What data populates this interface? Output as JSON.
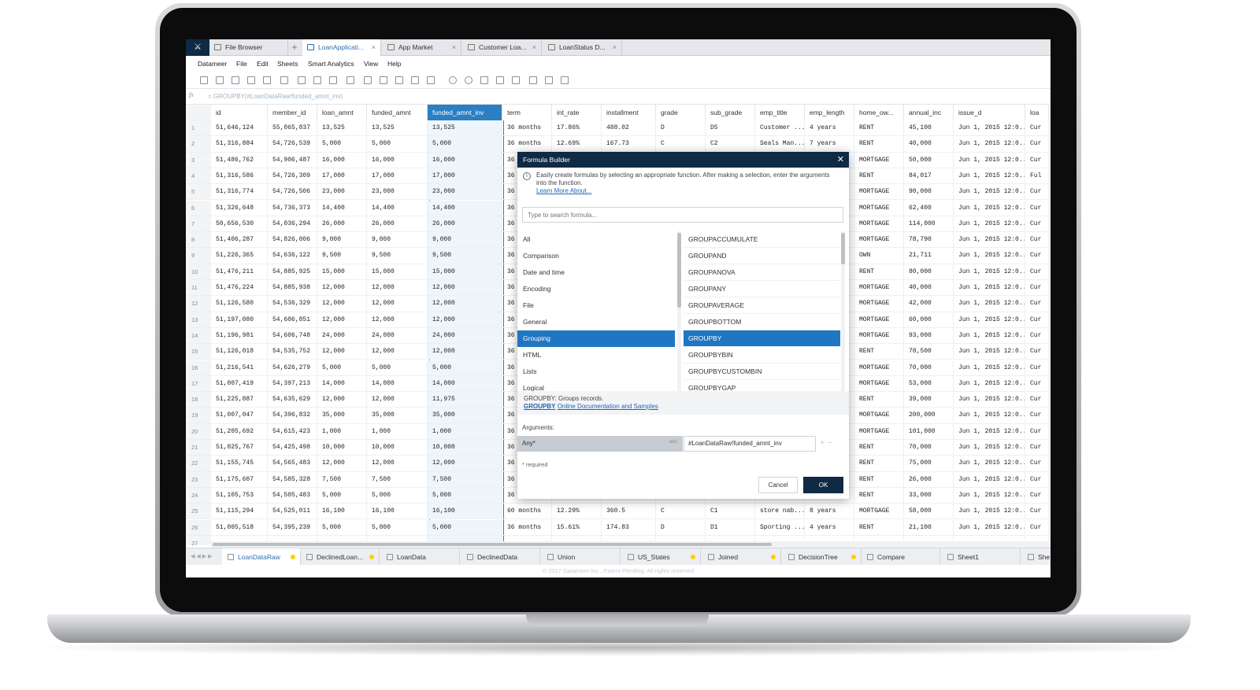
{
  "window_tabs": [
    {
      "label": "File Browser"
    },
    {
      "label": "LoanApplicati..."
    },
    {
      "label": "App Market"
    },
    {
      "label": "Customer Loa..."
    },
    {
      "label": "LoanStatus D..."
    }
  ],
  "menu": [
    "Datameer",
    "File",
    "Edit",
    "Sheets",
    "Smart Analytics",
    "View",
    "Help"
  ],
  "formula_bar": {
    "fx": "fx",
    "text": "= GROUPBY(#LoanDataRaw!funded_amnt_inv)"
  },
  "columns": [
    "id",
    "member_id",
    "loan_amnt",
    "funded_amnt",
    "funded_amnt_inv",
    "term",
    "int_rate",
    "installment",
    "grade",
    "sub_grade",
    "emp_title",
    "emp_length",
    "home_ow...",
    "annual_inc",
    "issue_d",
    "loa"
  ],
  "rows": [
    [
      "1",
      "51,646,124",
      "55,065,837",
      "13,525",
      "13,525",
      "13,525",
      "36 months",
      "17.86%",
      "488.02",
      "D",
      "D5",
      "Customer ...",
      "4 years",
      "RENT",
      "45,100",
      "Jun 1, 2015 12:0...",
      "Cur"
    ],
    [
      "2",
      "51,316,884",
      "54,726,539",
      "5,000",
      "5,000",
      "5,000",
      "36 months",
      "12.69%",
      "167.73",
      "C",
      "C2",
      "Seals Man...",
      "7 years",
      "RENT",
      "40,000",
      "Jun 1, 2015 12:0...",
      "Cur"
    ],
    [
      "3",
      "51,486,762",
      "54,906,487",
      "16,000",
      "16,000",
      "16,000",
      "36",
      "",
      "",
      "",
      "",
      "",
      "",
      "MORTGAGE",
      "50,000",
      "Jun 1, 2015 12:0...",
      "Cur"
    ],
    [
      "4",
      "51,316,586",
      "54,726,309",
      "17,000",
      "17,000",
      "17,000",
      "36",
      "",
      "",
      "",
      "",
      "",
      "",
      "RENT",
      "84,017",
      "Jun 1, 2015 12:0...",
      "Ful"
    ],
    [
      "5",
      "51,316,774",
      "54,726,506",
      "23,000",
      "23,000",
      "23,000",
      "36",
      "",
      "",
      "",
      "",
      "",
      "",
      "MORTGAGE",
      "90,000",
      "Jun 1, 2015 12:0...",
      "Cur"
    ],
    [
      "6",
      "51,326,648",
      "54,736,373",
      "14,400",
      "14,400",
      "14,400",
      "36",
      "",
      "",
      "",
      "",
      "",
      "",
      "MORTGAGE",
      "62,400",
      "Jun 1, 2015 12:0...",
      "Cur"
    ],
    [
      "7",
      "50,656,530",
      "54,036,294",
      "26,000",
      "26,000",
      "26,000",
      "36",
      "",
      "",
      "",
      "",
      "",
      "",
      "MORTGAGE",
      "114,000",
      "Jun 1, 2015 12:0...",
      "Cur"
    ],
    [
      "8",
      "51,406,287",
      "54,826,006",
      "9,000",
      "9,000",
      "9,000",
      "36",
      "",
      "",
      "",
      "",
      "",
      "",
      "MORTGAGE",
      "78,790",
      "Jun 1, 2015 12:0...",
      "Cur"
    ],
    [
      "9",
      "51,226,365",
      "54,636,122",
      "9,500",
      "9,500",
      "9,500",
      "36",
      "",
      "",
      "",
      "",
      "",
      "",
      "OWN",
      "21,711",
      "Jun 1, 2015 12:0...",
      "Cur"
    ],
    [
      "10",
      "51,476,211",
      "54,885,925",
      "15,000",
      "15,000",
      "15,000",
      "36",
      "",
      "",
      "",
      "",
      "",
      "",
      "RENT",
      "80,000",
      "Jun 1, 2015 12:0...",
      "Cur"
    ],
    [
      "11",
      "51,476,224",
      "54,885,938",
      "12,000",
      "12,000",
      "12,000",
      "36",
      "",
      "",
      "",
      "",
      "",
      "",
      "MORTGAGE",
      "40,000",
      "Jun 1, 2015 12:0...",
      "Cur"
    ],
    [
      "12",
      "51,126,580",
      "54,536,329",
      "12,000",
      "12,000",
      "12,000",
      "36",
      "",
      "",
      "",
      "",
      "",
      "",
      "MORTGAGE",
      "42,000",
      "Jun 1, 2015 12:0...",
      "Cur"
    ],
    [
      "13",
      "51,197,080",
      "54,606,851",
      "12,000",
      "12,000",
      "12,000",
      "36",
      "",
      "",
      "",
      "",
      "",
      "",
      "MORTGAGE",
      "60,000",
      "Jun 1, 2015 12:0...",
      "Cur"
    ],
    [
      "14",
      "51,196,981",
      "54,606,748",
      "24,000",
      "24,000",
      "24,000",
      "36",
      "",
      "",
      "",
      "",
      "",
      "",
      "MORTGAGE",
      "93,000",
      "Jun 1, 2015 12:0...",
      "Cur"
    ],
    [
      "15",
      "51,126,018",
      "54,535,752",
      "12,000",
      "12,000",
      "12,000",
      "36",
      "",
      "",
      "",
      "",
      "",
      "",
      "RENT",
      "78,500",
      "Jun 1, 2015 12:0...",
      "Cur"
    ],
    [
      "16",
      "51,216,541",
      "54,626,279",
      "5,000",
      "5,000",
      "5,000",
      "36",
      "",
      "",
      "",
      "",
      "",
      "",
      "MORTGAGE",
      "70,000",
      "Jun 1, 2015 12:0...",
      "Cur"
    ],
    [
      "17",
      "51,007,419",
      "54,397,213",
      "14,000",
      "14,000",
      "14,000",
      "36",
      "",
      "",
      "",
      "",
      "",
      "",
      "MORTGAGE",
      "53,000",
      "Jun 1, 2015 12:0...",
      "Cur"
    ],
    [
      "18",
      "51,225,887",
      "54,635,629",
      "12,000",
      "12,000",
      "11,975",
      "36",
      "",
      "",
      "",
      "",
      "",
      "",
      "RENT",
      "39,000",
      "Jun 1, 2015 12:0...",
      "Cur"
    ],
    [
      "19",
      "51,007,047",
      "54,396,832",
      "35,000",
      "35,000",
      "35,000",
      "36",
      "",
      "",
      "",
      "",
      "",
      "",
      "MORTGAGE",
      "200,000",
      "Jun 1, 2015 12:0...",
      "Cur"
    ],
    [
      "20",
      "51,205,692",
      "54,615,423",
      "1,000",
      "1,000",
      "1,000",
      "36",
      "",
      "",
      "",
      "",
      "",
      "",
      "MORTGAGE",
      "101,000",
      "Jun 1, 2015 12:0...",
      "Cur"
    ],
    [
      "21",
      "51,025,767",
      "54,425,498",
      "10,000",
      "10,000",
      "10,000",
      "36",
      "",
      "",
      "",
      "",
      "",
      "",
      "RENT",
      "70,000",
      "Jun 1, 2015 12:0...",
      "Cur"
    ],
    [
      "22",
      "51,155,745",
      "54,565,483",
      "12,000",
      "12,000",
      "12,000",
      "36",
      "",
      "",
      "",
      "",
      "",
      "",
      "RENT",
      "75,000",
      "Jun 1, 2015 12:0...",
      "Cur"
    ],
    [
      "23",
      "51,175,607",
      "54,585,328",
      "7,500",
      "7,500",
      "7,500",
      "36",
      "",
      "",
      "",
      "",
      "",
      "",
      "RENT",
      "26,000",
      "Jun 1, 2015 12:0...",
      "Cur"
    ],
    [
      "24",
      "51,105,753",
      "54,505,483",
      "5,000",
      "5,000",
      "5,000",
      "36",
      "",
      "",
      "",
      "",
      "",
      "",
      "RENT",
      "33,000",
      "Jun 1, 2015 12:0...",
      "Cur"
    ],
    [
      "25",
      "51,115,294",
      "54,525,011",
      "16,100",
      "16,100",
      "16,100",
      "60 months",
      "12.29%",
      "360.5",
      "C",
      "C1",
      "store nab...",
      "8 years",
      "MORTGAGE",
      "58,000",
      "Jun 1, 2015 12:0...",
      "Cur"
    ],
    [
      "26",
      "51,005,518",
      "54,395,239",
      "5,000",
      "5,000",
      "5,000",
      "36 months",
      "15.61%",
      "174.83",
      "D",
      "D1",
      "Sporting ...",
      "4 years",
      "RENT",
      "21,100",
      "Jun 1, 2015 12:0...",
      "Cur"
    ],
    [
      "27",
      "",
      "",
      "",
      "",
      "",
      "",
      "",
      "",
      "",
      "",
      "",
      "",
      "",
      "",
      "",
      ""
    ]
  ],
  "sheet_tabs": [
    "LoanDataRaw",
    "DeclinedLoan...",
    "LoanData",
    "DeclinedData",
    "Union",
    "US_States",
    "Joined",
    "DecisionTree",
    "Compare",
    "Sheet1",
    "She"
  ],
  "footer": "© 2017 Datameer Inc., Patent Pending. All rights reserved",
  "dialog": {
    "title": "Formula Builder",
    "help": "Easily create formulas by selecting an appropriate function. After making a selection, enter the arguments into the function.",
    "learn_more": "Learn More About...",
    "search_placeholder": "Type to search formula...",
    "categories": [
      "All",
      "Comparison",
      "Date and time",
      "Encoding",
      "File",
      "General",
      "Grouping",
      "HTML",
      "Lists",
      "Logical"
    ],
    "selected_category": "Grouping",
    "functions": [
      "GROUPACCUMULATE",
      "GROUPAND",
      "GROUPANOVA",
      "GROUPANY",
      "GROUPAVERAGE",
      "GROUPBOTTOM",
      "GROUPBY",
      "GROUPBYBIN",
      "GROUPBYCUSTOMBIN",
      "GROUPBYGAP"
    ],
    "selected_function": "GROUPBY",
    "description": "GROUPBY: Groups records.",
    "doc_fn": "GROUPBY",
    "doc_link": "Online Documentation and Samples",
    "arguments_label": "Arguments:",
    "arg_name": "Any*",
    "arg_type": "abc",
    "arg_value": "#LoanDataRaw!funded_amnt_inv",
    "required_note": "* required",
    "cancel": "Cancel",
    "ok": "OK"
  },
  "colors": {
    "accent": "#2b7fc3",
    "navy": "#0f2a44",
    "selected_row": "#1f76c2",
    "dot": "#f5d400"
  }
}
